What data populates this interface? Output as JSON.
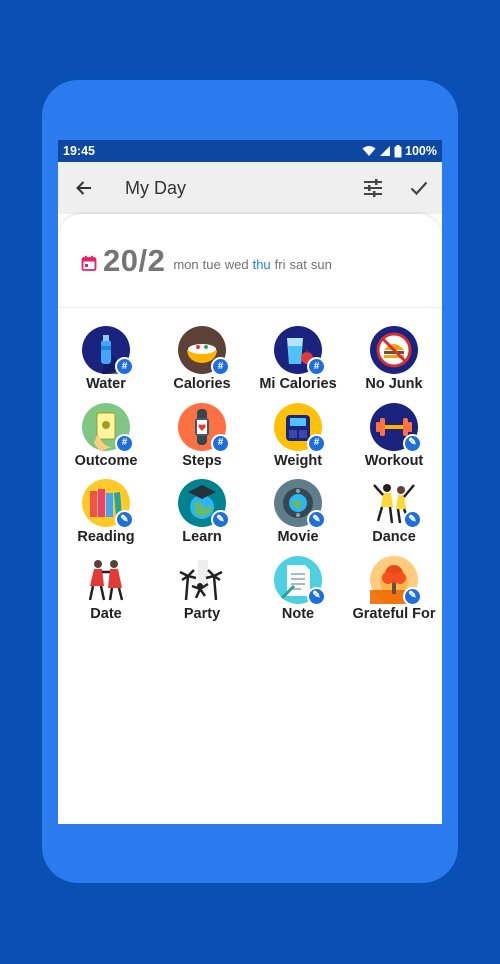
{
  "status_bar": {
    "time": "19:45",
    "battery": "100%"
  },
  "app_bar": {
    "title": "My Day"
  },
  "date": {
    "day": "20/2",
    "weekdays": [
      "mon",
      "tue",
      "wed",
      "thu",
      "fri",
      "sat",
      "sun"
    ],
    "active_weekday": "thu"
  },
  "colors": {
    "accent": "#1e7fd8",
    "calendar_icon": "#e91e63",
    "frame": "#2b7bee",
    "background": "#0a4fb4"
  },
  "habits": [
    {
      "label": "Water",
      "icon": "water-bottle-icon",
      "badge": "#"
    },
    {
      "label": "Calories",
      "icon": "food-bowl-icon",
      "badge": "#"
    },
    {
      "label": "Mi Calories",
      "icon": "glass-apple-icon",
      "badge": "#"
    },
    {
      "label": "No Junk",
      "icon": "no-junk-food-icon",
      "badge": ""
    },
    {
      "label": "Outcome",
      "icon": "money-hand-icon",
      "badge": "#"
    },
    {
      "label": "Steps",
      "icon": "fitness-tracker-icon",
      "badge": "#"
    },
    {
      "label": "Weight",
      "icon": "scale-icon",
      "badge": "#"
    },
    {
      "label": "Workout",
      "icon": "dumbbell-icon",
      "badge": "✎"
    },
    {
      "label": "Reading",
      "icon": "books-icon",
      "badge": "✎"
    },
    {
      "label": "Learn",
      "icon": "graduation-globe-icon",
      "badge": "✎"
    },
    {
      "label": "Movie",
      "icon": "film-reel-icon",
      "badge": "✎"
    },
    {
      "label": "Dance",
      "icon": "dancers-icon",
      "badge": "✎"
    },
    {
      "label": "Date",
      "icon": "couple-dancing-icon",
      "badge": ""
    },
    {
      "label": "Party",
      "icon": "party-palms-icon",
      "badge": ""
    },
    {
      "label": "Note",
      "icon": "notepad-icon",
      "badge": "✎"
    },
    {
      "label": "Grateful For",
      "icon": "sunset-tree-icon",
      "badge": "✎"
    }
  ]
}
